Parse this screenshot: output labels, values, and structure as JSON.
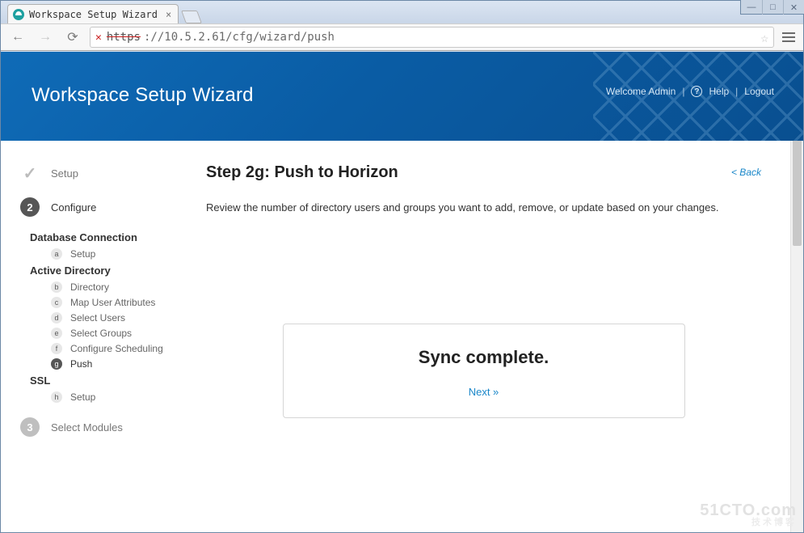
{
  "window": {
    "tab_title": "Workspace Setup Wizard",
    "url_scheme": "https",
    "url_rest": "://10.5.2.61/cfg/wizard/push"
  },
  "banner": {
    "title": "Workspace Setup Wizard",
    "welcome": "Welcome Admin",
    "help": "Help",
    "logout": "Logout"
  },
  "sidebar": {
    "majors": [
      {
        "num": "✓",
        "label": "Setup",
        "state": "done"
      },
      {
        "num": "2",
        "label": "Configure",
        "state": "current"
      },
      {
        "num": "3",
        "label": "Select Modules",
        "state": "upcoming"
      }
    ],
    "group1_title": "Database Connection",
    "group1": [
      {
        "letter": "a",
        "label": "Setup",
        "active": false
      }
    ],
    "group2_title": "Active Directory",
    "group2": [
      {
        "letter": "b",
        "label": "Directory",
        "active": false
      },
      {
        "letter": "c",
        "label": "Map User Attributes",
        "active": false
      },
      {
        "letter": "d",
        "label": "Select Users",
        "active": false
      },
      {
        "letter": "e",
        "label": "Select Groups",
        "active": false
      },
      {
        "letter": "f",
        "label": "Configure Scheduling",
        "active": false
      },
      {
        "letter": "g",
        "label": "Push",
        "active": true
      }
    ],
    "group3_title": "SSL",
    "group3": [
      {
        "letter": "h",
        "label": "Setup",
        "active": false
      }
    ]
  },
  "main": {
    "heading": "Step 2g: Push to Horizon",
    "back": "< Back",
    "description": "Review the number of directory users and groups you want to add, remove, or update based on your changes.",
    "sync_message": "Sync complete.",
    "next": "Next »"
  },
  "watermark": {
    "big": "51CTO.com",
    "small": "技术博客"
  }
}
